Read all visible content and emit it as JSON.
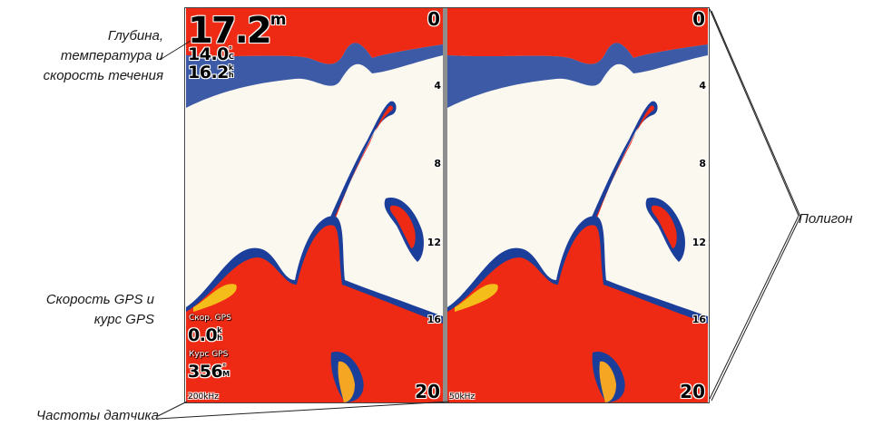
{
  "callouts": {
    "depth_temp_speed": [
      "Глубина,",
      "температура и",
      "скорость течения"
    ],
    "gps": [
      "Скорость GPS и",
      "курс GPS"
    ],
    "frequencies": "Частоты датчика",
    "polygon": "Полигон"
  },
  "left_panel": {
    "depth_value": "17.2",
    "depth_unit": "m",
    "temperature_value": "14.0",
    "temperature_unit_top": "°",
    "temperature_unit_bottom": "C",
    "speed_value": "16.2",
    "speed_unit_top": "k",
    "speed_unit_bottom": "h",
    "gps_speed_label": "Скор. GPS",
    "gps_speed_value": "0.0",
    "gps_speed_unit_top": "k",
    "gps_speed_unit_bottom": "h",
    "gps_course_label": "Курс GPS",
    "gps_course_value": "356",
    "gps_course_unit_top": "°",
    "gps_course_unit_bottom": "M",
    "frequency": "200kHz"
  },
  "right_panel": {
    "frequency": "50kHz"
  },
  "depth_scale": {
    "top": "0",
    "marks": [
      "4",
      "8",
      "12",
      "16"
    ],
    "bottom": "20"
  },
  "colors": {
    "sonar_red": "#ee2a14",
    "sonar_orange": "#f5a623",
    "sonar_yellow": "#f6e21a",
    "sonar_blue": "#1b3e9a",
    "sonar_light_blue": "#5fa7d9",
    "background": "#fbf8f0",
    "divider": "#8e8e8e"
  }
}
